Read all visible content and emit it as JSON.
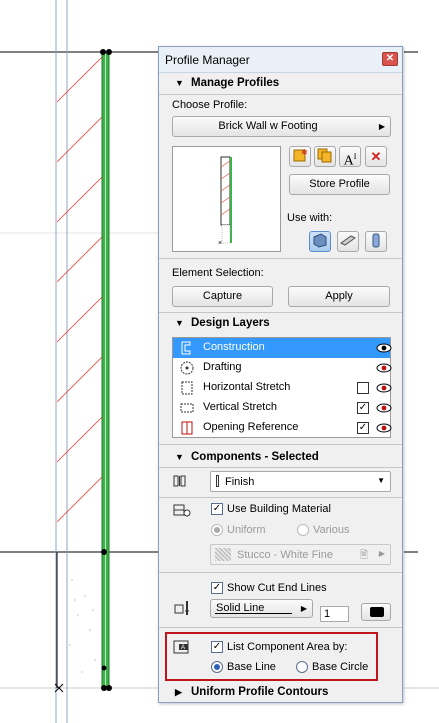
{
  "panel": {
    "title": "Profile Manager",
    "close_icon": "close-icon"
  },
  "manage_profiles": {
    "heading": "Manage Profiles",
    "choose_label": "Choose Profile:",
    "profile_selected": "Brick Wall w Footing",
    "store_button": "Store Profile",
    "use_with_label": "Use with:",
    "element_selection_label": "Element Selection:",
    "capture_button": "Capture",
    "apply_button": "Apply",
    "tool_icons": [
      "new-profile-icon",
      "duplicate-profile-icon",
      "rename-profile-icon",
      "delete-profile-icon"
    ],
    "use_with_icons": [
      "wall-icon",
      "beam-icon",
      "column-icon"
    ]
  },
  "design_layers": {
    "heading": "Design Layers",
    "rows": [
      {
        "label": "Construction",
        "checkbox": "",
        "selected": true
      },
      {
        "label": "Drafting",
        "checkbox": "",
        "selected": false
      },
      {
        "label": "Horizontal Stretch",
        "checkbox": "",
        "selected": false
      },
      {
        "label": "Vertical Stretch",
        "checkbox": "✓",
        "selected": false
      },
      {
        "label": "Opening Reference",
        "checkbox": "✓",
        "selected": false
      }
    ]
  },
  "components": {
    "heading": "Components - Selected",
    "finish_value": "Finish",
    "use_building_material": "Use Building Material",
    "uniform_label": "Uniform",
    "various_label": "Various",
    "material_value": "Stucco - White Fine",
    "show_cut_end_lines": "Show Cut End Lines",
    "line_type": "Solid Line",
    "pen_number": "1",
    "list_component_area": "List Component Area by:",
    "base_line": "Base Line",
    "base_circle": "Base Circle"
  },
  "uniform_contours": {
    "heading": "Uniform Profile Contours"
  },
  "colors": {
    "accent": "#3399ff",
    "highlight_border": "#c0151d",
    "wall_green": "#3cb44b"
  }
}
